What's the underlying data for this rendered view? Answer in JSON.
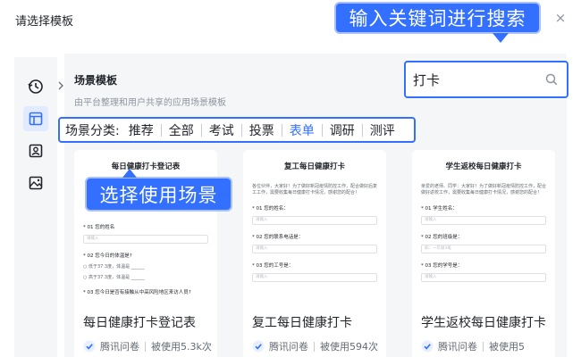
{
  "dialog": {
    "title": "请选择模板",
    "close": "×"
  },
  "sidebar": {
    "items": [
      {
        "icon": "history-icon"
      },
      {
        "icon": "template-icon"
      },
      {
        "icon": "contact-icon"
      },
      {
        "icon": "image-icon"
      }
    ]
  },
  "section": {
    "title": "场景模板",
    "subtitle": "由平台整理和用户共享的应用场景模板"
  },
  "search": {
    "value": "打卡"
  },
  "callouts": {
    "top": "输入关键词进行搜索",
    "middle": "选择使用场景"
  },
  "filter": {
    "label": "场景分类:",
    "items": [
      "推荐",
      "全部",
      "考试",
      "投票",
      "表单",
      "调研",
      "测评"
    ],
    "active_index": 4
  },
  "cards": [
    {
      "preview_title": "每日健康打卡登记表",
      "name": "每日健康打卡登记表",
      "source": "腾讯问卷",
      "usage": "被使用5.3k次",
      "q1": "* 01 您的姓名",
      "f1": "请输入",
      "q2": "* 02 您今日的体温是?",
      "r1": "○ 低于37.3度，体温是 ______",
      "r2": "○ 高于37.3度，体温是 ______",
      "q3": "* 03 您今日是否有接触从中高风险地区来访人员?"
    },
    {
      "preview_title": "复工每日健康打卡",
      "name": "复工每日健康打卡",
      "source": "腾讯问卷",
      "usage": "被使用594次",
      "desc": "各位伙伴，大家好！为了做好新冠疫情防控工作，配合做好后复工工作，需要收集每日健康打卡情况，感谢您的配合！",
      "q1": "* 01 您的姓名：",
      "f1": "请输入",
      "q2": "* 02 您的联系电话是：",
      "f2": "请输入",
      "q3": "* 03 您的工号是：",
      "f3": "请输入"
    },
    {
      "preview_title": "学生返校每日健康打卡",
      "name": "学生返校每日健康打卡",
      "source": "腾讯问卷",
      "usage": "被使用5",
      "desc": "亲爱的老师、同学：大家好！为了做好新冠疫情防控工作，配合做好返校工作，需要收集每日健康打卡情况，感谢您的配合！",
      "q1": "* 01 学生姓名：",
      "f1": "请输入",
      "q2": "* 02 您的班级是：",
      "f2": "如：一年级3班",
      "q3": "* 03 您的学号是：",
      "f3": "请输入"
    }
  ],
  "colors": {
    "accent": "#3370ff",
    "panel": "#f5f6f7"
  }
}
